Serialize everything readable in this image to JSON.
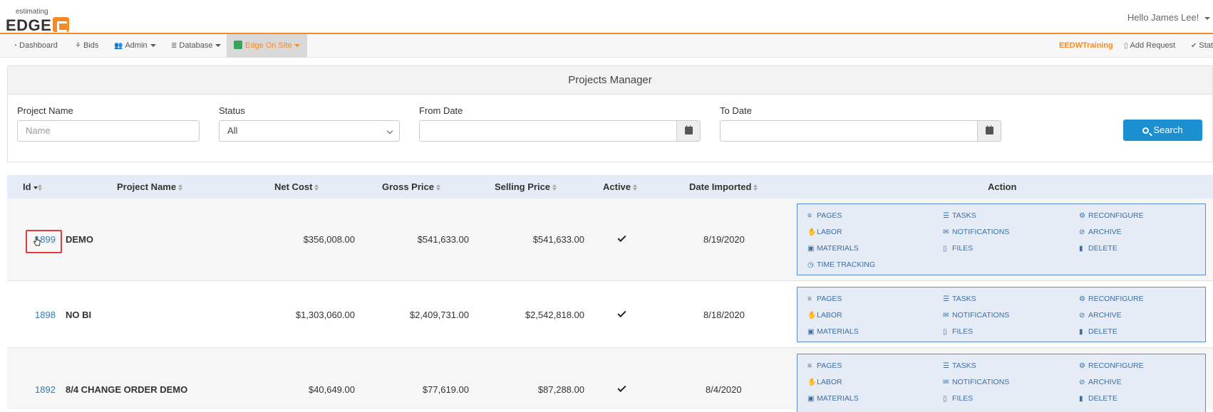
{
  "header": {
    "logo_small": "estimating",
    "logo_main": "EDGE",
    "greeting": "Hello James Lee!"
  },
  "nav": {
    "dashboard": "Dashboard",
    "bids": "Bids",
    "admin": "Admin",
    "database": "Database",
    "edge_on_site": "Edge On Site",
    "training": "EEDWTraining",
    "add_request": "Add Request",
    "status": "Stat"
  },
  "filters": {
    "panel_title": "Projects Manager",
    "project_name_label": "Project Name",
    "project_name_placeholder": "Name",
    "status_label": "Status",
    "status_value": "All",
    "from_date_label": "From Date",
    "to_date_label": "To Date",
    "search_label": "Search"
  },
  "table": {
    "headers": {
      "id": "Id",
      "project_name": "Project Name",
      "net_cost": "Net Cost",
      "gross_price": "Gross Price",
      "selling_price": "Selling Price",
      "active": "Active",
      "date_imported": "Date Imported",
      "action": "Action"
    },
    "rows": [
      {
        "id": "1899",
        "name": "DEMO",
        "net_cost": "$356,008.00",
        "gross_price": "$541,633.00",
        "selling_price": "$541,633.00",
        "active": true,
        "date": "8/19/2020"
      },
      {
        "id": "1898",
        "name": "NO BI",
        "net_cost": "$1,303,060.00",
        "gross_price": "$2,409,731.00",
        "selling_price": "$2,542,818.00",
        "active": true,
        "date": "8/18/2020"
      },
      {
        "id": "1892",
        "name": "8/4 CHANGE ORDER DEMO",
        "net_cost": "$40,649.00",
        "gross_price": "$77,619.00",
        "selling_price": "$87,288.00",
        "active": true,
        "date": "8/4/2020"
      }
    ],
    "actions": {
      "pages": "PAGES",
      "tasks": "TASKS",
      "reconfigure": "RECONFIGURE",
      "labor": "LABOR",
      "notifications": "NOTIFICATIONS",
      "archive": "ARCHIVE",
      "materials": "MATERIALS",
      "files": "FILES",
      "delete": "DELETE",
      "time_tracking": "TIME TRACKING"
    }
  },
  "colors": {
    "accent": "#f28c28",
    "link": "#337ab7",
    "search_button": "#1b8fd0",
    "highlight": "#e23b3b"
  }
}
